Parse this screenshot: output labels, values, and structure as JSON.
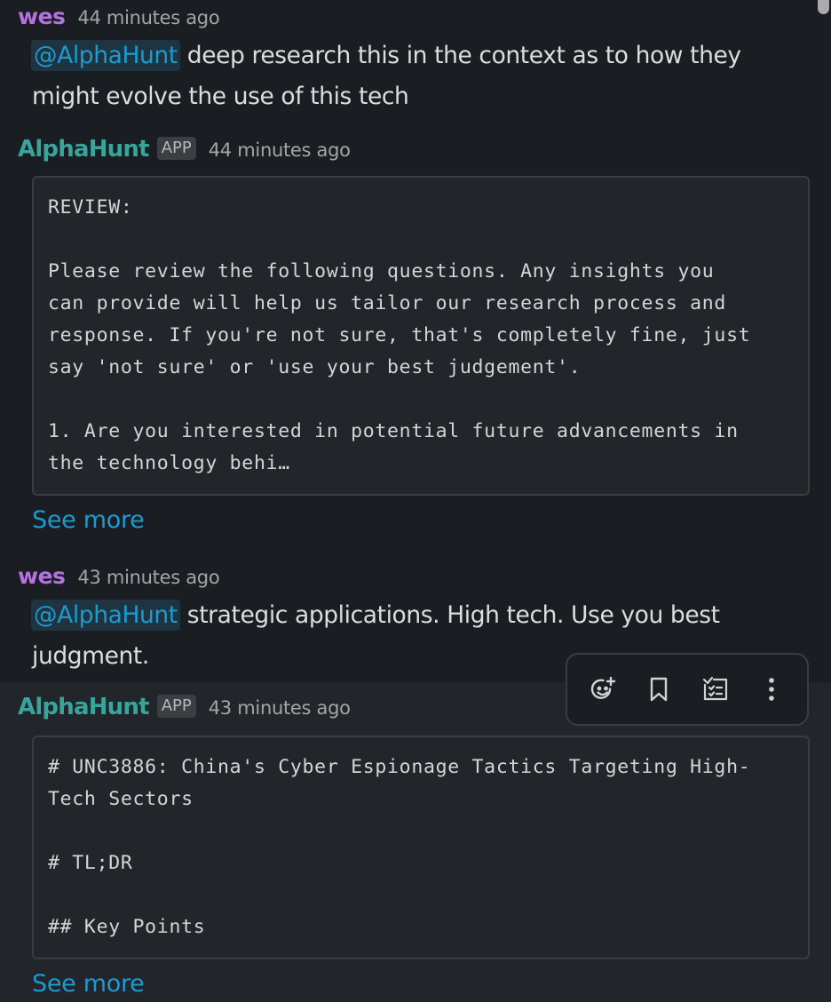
{
  "messages": [
    {
      "author": "wes",
      "time": "44 minutes ago",
      "mention": "@AlphaHunt",
      "text_line1": " deep research this in the context as to how they",
      "text_line2": "might evolve the use of this tech"
    },
    {
      "author": "AlphaHunt",
      "badge": "APP",
      "time": "44 minutes ago",
      "code": "REVIEW:\n\nPlease review the following questions. Any insights you\ncan provide will help us tailor our research process and\nresponse. If you're not sure, that's completely fine, just\nsay 'not sure' or 'use your best judgement'.\n\n1. Are you interested in potential future advancements in\nthe technology behi…",
      "see_more": "See more"
    },
    {
      "author": "wes",
      "time": "43 minutes ago",
      "mention": "@AlphaHunt",
      "text_line1": " strategic applications. High tech. Use you best",
      "text_line2": "judgment."
    },
    {
      "author": "AlphaHunt",
      "badge": "APP",
      "time": "43 minutes ago",
      "code": "# UNC3886: China's Cyber Espionage Tactics Targeting High-\nTech Sectors\n\n# TL;DR\n\n## Key Points",
      "see_more": "See more"
    }
  ],
  "toolbar": {
    "icons": [
      "add-reaction-icon",
      "bookmark-icon",
      "add-to-list-icon",
      "more-actions-icon"
    ]
  },
  "colors": {
    "background": "#1a1d21",
    "user_name": "#b572e0",
    "app_name": "#38a49c",
    "link": "#1d9bd1"
  }
}
